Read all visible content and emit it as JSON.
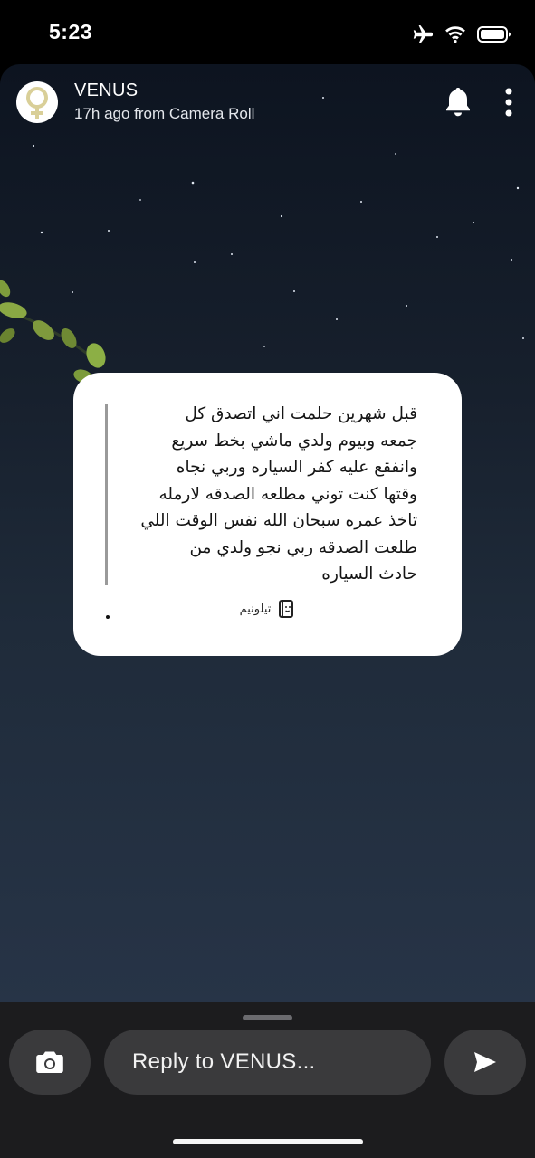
{
  "status_bar": {
    "time": "5:23",
    "icons": [
      "airplane-icon",
      "wifi-icon",
      "battery-icon"
    ]
  },
  "header": {
    "name": "VENUS",
    "subtitle": "17h ago from Camera Roll",
    "icons": [
      "venus-symbol-icon",
      "bell-icon",
      "more-vertical-icon"
    ]
  },
  "card": {
    "message": "قبل شهرين حلمت اني اتصدق كل\nجمعه وبيوم ولدي ماشي بخط سريع\nوانفقع عليه كفر السياره وربي نجاه\nوقتها كنت توني مطلعه الصدقه لارمله\nتاخذ عمره سبحان الله نفس الوقت اللي\nطلعت الصدقه ربي نجو ولدي من\nحادث السياره",
    "dot": "."
  },
  "tag": {
    "label": "تيلونيم"
  },
  "reply": {
    "placeholder": "Reply to VENUS..."
  },
  "colors": {
    "card_bg": "#ffffff",
    "bar_bg": "#1c1c1e",
    "button_bg": "#3a3a3c"
  }
}
